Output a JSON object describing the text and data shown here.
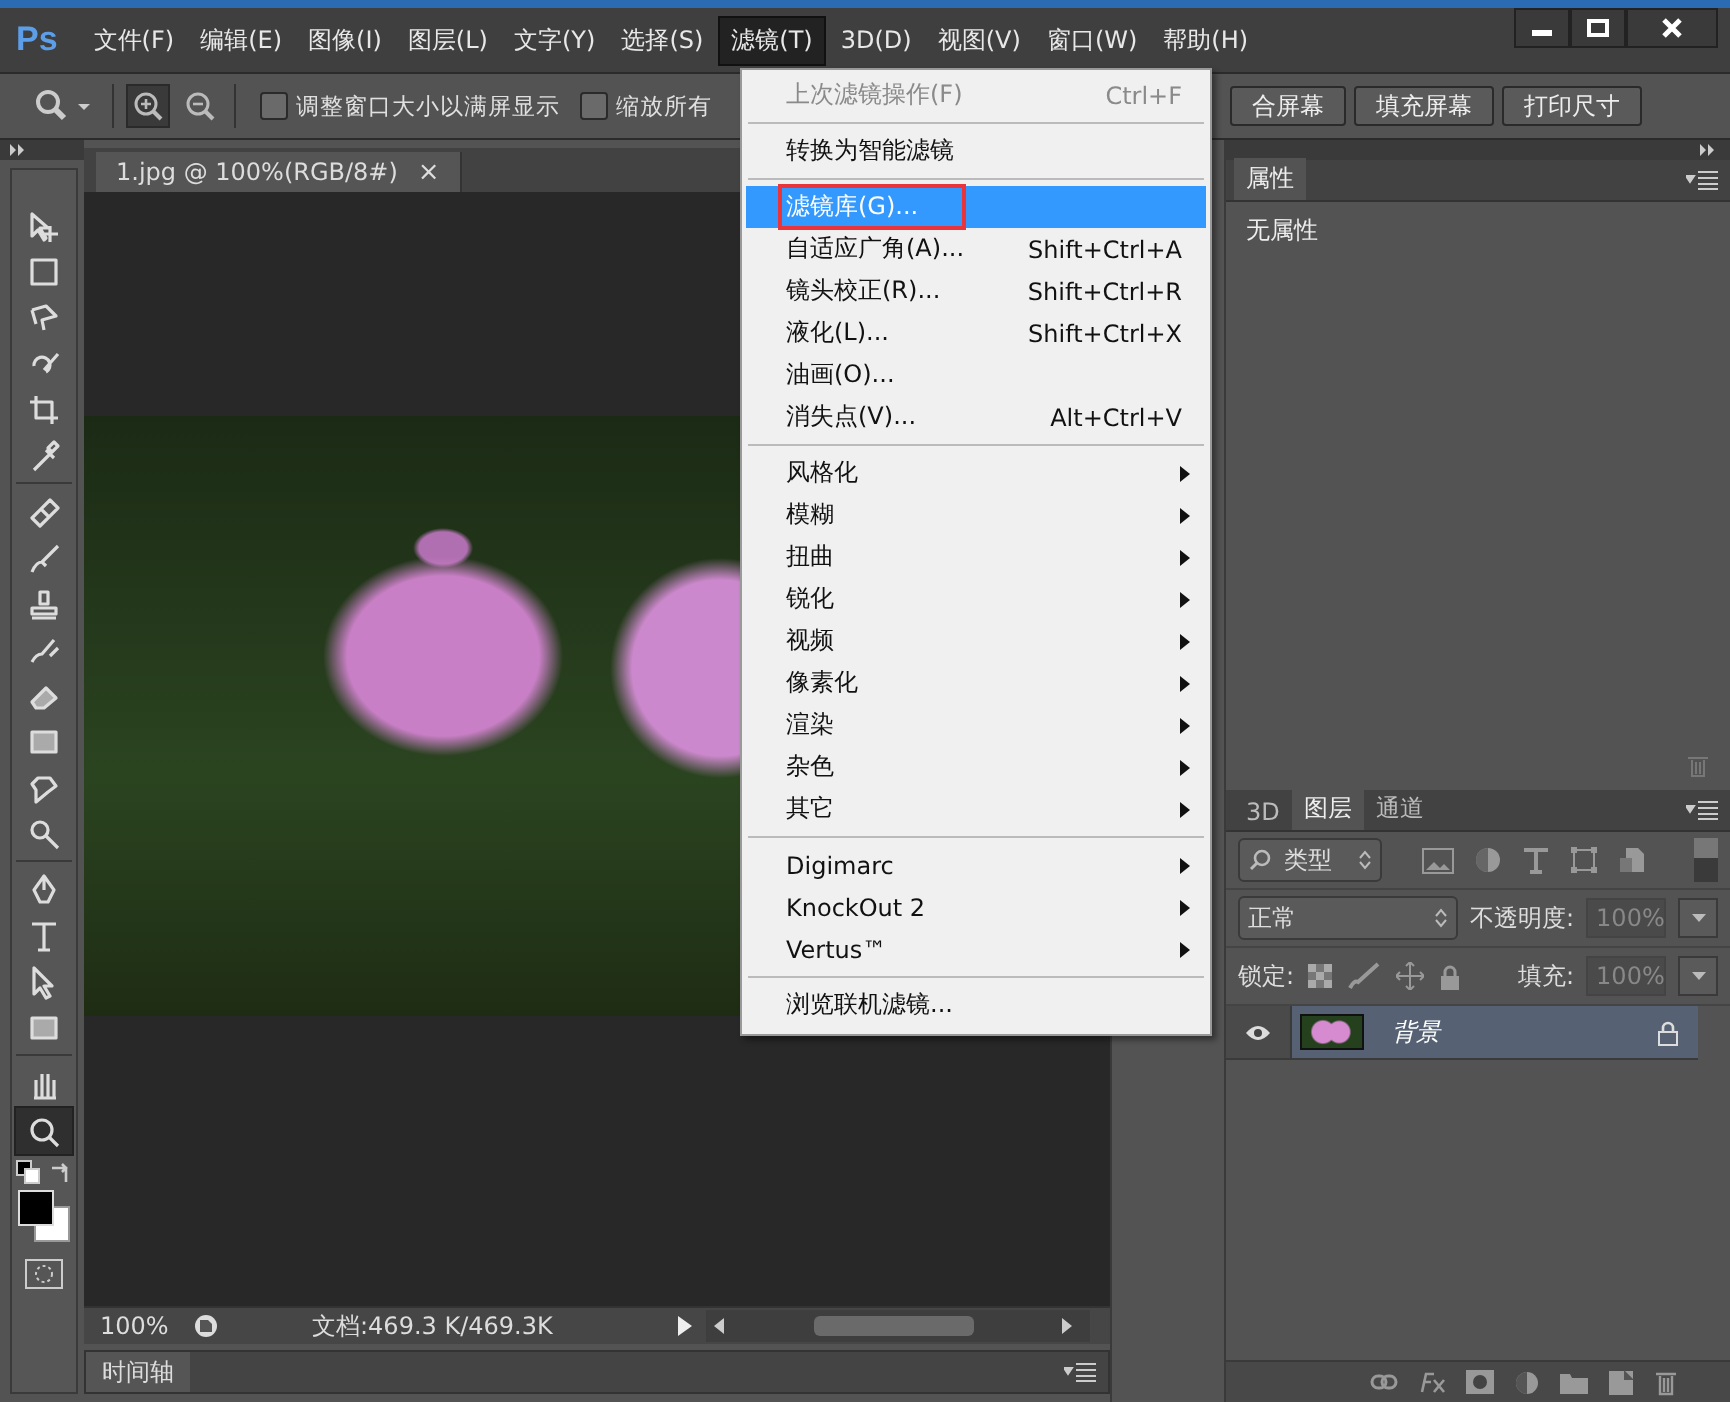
{
  "app_logo": "Ps",
  "menu_bar": [
    {
      "label": "文件(F)",
      "open": false
    },
    {
      "label": "编辑(E)",
      "open": false
    },
    {
      "label": "图像(I)",
      "open": false
    },
    {
      "label": "图层(L)",
      "open": false
    },
    {
      "label": "文字(Y)",
      "open": false
    },
    {
      "label": "选择(S)",
      "open": false
    },
    {
      "label": "滤镜(T)",
      "open": true
    },
    {
      "label": "3D(D)",
      "open": false
    },
    {
      "label": "视图(V)",
      "open": false
    },
    {
      "label": "窗口(W)",
      "open": false
    },
    {
      "label": "帮助(H)",
      "open": false
    }
  ],
  "options_bar": {
    "zoom_buttons": [
      {
        "kind": "zoom-in",
        "selected": true
      },
      {
        "kind": "zoom-out",
        "selected": false
      }
    ],
    "checkboxes": [
      {
        "label": "调整窗口大小以满屏显示",
        "checked": false
      },
      {
        "label": "缩放所有",
        "checked": false
      }
    ],
    "buttons": [
      "合屏幕",
      "填充屏幕",
      "打印尺寸"
    ]
  },
  "tool_groups": [
    [
      {
        "kind": "move",
        "selected": false
      },
      {
        "kind": "marquee",
        "selected": false
      },
      {
        "kind": "lasso",
        "selected": false
      },
      {
        "kind": "quick-select",
        "selected": false
      },
      {
        "kind": "crop",
        "selected": false
      },
      {
        "kind": "eyedropper",
        "selected": false
      }
    ],
    [
      {
        "kind": "healing",
        "selected": false
      },
      {
        "kind": "brush",
        "selected": false
      },
      {
        "kind": "stamp",
        "selected": false
      },
      {
        "kind": "history",
        "selected": false
      },
      {
        "kind": "eraser",
        "selected": false
      },
      {
        "kind": "gradient",
        "selected": false
      },
      {
        "kind": "smudge",
        "selected": false
      },
      {
        "kind": "dodge",
        "selected": false
      }
    ],
    [
      {
        "kind": "pen",
        "selected": false
      },
      {
        "kind": "type",
        "selected": false
      },
      {
        "kind": "path-select",
        "selected": false
      },
      {
        "kind": "rectangle",
        "selected": false
      }
    ],
    [
      {
        "kind": "hand",
        "selected": false
      },
      {
        "kind": "zoom",
        "selected": true
      }
    ]
  ],
  "document": {
    "tab": "1.jpg @ 100%(RGB/8#)",
    "close": "×",
    "zoom": "100%",
    "doc_info": "文档:469.3 K/469.3K"
  },
  "timeline": {
    "title": "时间轴"
  },
  "filter_menu": [
    {
      "kind": "item",
      "label": "上次滤镜操作(F)",
      "shortcut": "Ctrl+F",
      "disabled": true,
      "selected": false,
      "highlighted": false,
      "submenu": false
    },
    {
      "kind": "separator"
    },
    {
      "kind": "item",
      "label": "转换为智能滤镜",
      "disabled": false,
      "selected": false,
      "highlighted": false,
      "submenu": false
    },
    {
      "kind": "separator"
    },
    {
      "kind": "item",
      "label": "滤镜库(G)...",
      "disabled": false,
      "selected": true,
      "highlighted": true,
      "submenu": false
    },
    {
      "kind": "item",
      "label": "自适应广角(A)...",
      "shortcut": "Shift+Ctrl+A",
      "disabled": false,
      "selected": false,
      "highlighted": false,
      "submenu": false
    },
    {
      "kind": "item",
      "label": "镜头校正(R)...",
      "shortcut": "Shift+Ctrl+R",
      "disabled": false,
      "selected": false,
      "highlighted": false,
      "submenu": false
    },
    {
      "kind": "item",
      "label": "液化(L)...",
      "shortcut": "Shift+Ctrl+X",
      "disabled": false,
      "selected": false,
      "highlighted": false,
      "submenu": false
    },
    {
      "kind": "item",
      "label": "油画(O)...",
      "disabled": false,
      "selected": false,
      "highlighted": false,
      "submenu": false
    },
    {
      "kind": "item",
      "label": "消失点(V)...",
      "shortcut": "Alt+Ctrl+V",
      "disabled": false,
      "selected": false,
      "highlighted": false,
      "submenu": false
    },
    {
      "kind": "separator"
    },
    {
      "kind": "item",
      "label": "风格化",
      "disabled": false,
      "selected": false,
      "highlighted": false,
      "submenu": true
    },
    {
      "kind": "item",
      "label": "模糊",
      "disabled": false,
      "selected": false,
      "highlighted": false,
      "submenu": true
    },
    {
      "kind": "item",
      "label": "扭曲",
      "disabled": false,
      "selected": false,
      "highlighted": false,
      "submenu": true
    },
    {
      "kind": "item",
      "label": "锐化",
      "disabled": false,
      "selected": false,
      "highlighted": false,
      "submenu": true
    },
    {
      "kind": "item",
      "label": "视频",
      "disabled": false,
      "selected": false,
      "highlighted": false,
      "submenu": true
    },
    {
      "kind": "item",
      "label": "像素化",
      "disabled": false,
      "selected": false,
      "highlighted": false,
      "submenu": true
    },
    {
      "kind": "item",
      "label": "渲染",
      "disabled": false,
      "selected": false,
      "highlighted": false,
      "submenu": true
    },
    {
      "kind": "item",
      "label": "杂色",
      "disabled": false,
      "selected": false,
      "highlighted": false,
      "submenu": true
    },
    {
      "kind": "item",
      "label": "其它",
      "disabled": false,
      "selected": false,
      "highlighted": false,
      "submenu": true
    },
    {
      "kind": "separator"
    },
    {
      "kind": "item",
      "label": "Digimarc",
      "disabled": false,
      "selected": false,
      "highlighted": false,
      "submenu": true
    },
    {
      "kind": "item",
      "label": "KnockOut 2",
      "disabled": false,
      "selected": false,
      "highlighted": false,
      "submenu": true
    },
    {
      "kind": "item",
      "label": "Vertus™",
      "disabled": false,
      "selected": false,
      "highlighted": false,
      "submenu": true
    },
    {
      "kind": "separator"
    },
    {
      "kind": "item",
      "label": "浏览联机滤镜...",
      "disabled": false,
      "selected": false,
      "highlighted": false,
      "submenu": false
    }
  ],
  "properties_panel": {
    "tab": "属性",
    "content": "无属性"
  },
  "layers_panel": {
    "tabs": [
      {
        "label": "3D",
        "selected": false
      },
      {
        "label": "图层",
        "selected": true
      },
      {
        "label": "通道",
        "selected": false
      }
    ],
    "filter": "类型",
    "blend_mode": "正常",
    "opacity_label": "不透明度:",
    "opacity": "100%",
    "lock_label": "锁定:",
    "fill_label": "填充:",
    "fill": "100%",
    "layers": [
      {
        "name": "背景",
        "visible": true,
        "locked": true,
        "selected": true
      }
    ]
  }
}
